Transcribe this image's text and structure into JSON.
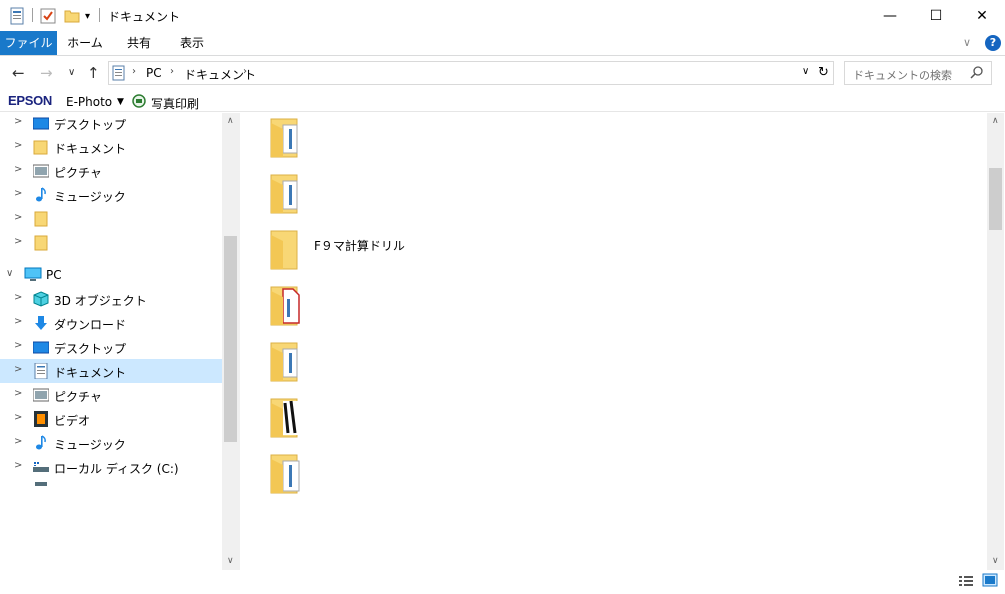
{
  "window": {
    "title": "ドキュメント",
    "minimize_glyph": "—",
    "maximize_glyph": "☐",
    "close_glyph": "✕"
  },
  "ribbon": {
    "tabs": [
      "ファイル",
      "ホーム",
      "共有",
      "表示"
    ],
    "help_glyph": "?"
  },
  "address": {
    "crumbs": [
      "PC",
      "ドキュメント"
    ],
    "search_placeholder": "ドキュメントの検索"
  },
  "epson": {
    "logo": "EPSON",
    "app": "E-Photo",
    "print_label": "写真印刷"
  },
  "nav": {
    "items": [
      {
        "label": "デスクトップ",
        "icon": "desktop-icon"
      },
      {
        "label": "ドキュメント",
        "icon": "folder-icon"
      },
      {
        "label": "ピクチャ",
        "icon": "pictures-icon"
      },
      {
        "label": "ミュージック",
        "icon": "music-icon"
      },
      {
        "label": "",
        "icon": "folder-icon"
      },
      {
        "label": "",
        "icon": "folder-icon"
      },
      {
        "label": "PC",
        "icon": "pc-icon"
      },
      {
        "label": "3D オブジェクト",
        "icon": "3d-objects-icon"
      },
      {
        "label": "ダウンロード",
        "icon": "download-icon"
      },
      {
        "label": "デスクトップ",
        "icon": "desktop-icon"
      },
      {
        "label": "ドキュメント",
        "icon": "documents-icon"
      },
      {
        "label": "ピクチャ",
        "icon": "pictures-icon"
      },
      {
        "label": "ビデオ",
        "icon": "video-icon"
      },
      {
        "label": "ミュージック",
        "icon": "music-icon"
      },
      {
        "label": "ローカル ディスク (C:)",
        "icon": "drive-icon"
      }
    ]
  },
  "files": [
    {
      "name": ""
    },
    {
      "name": ""
    },
    {
      "name": "F９マ計算ドリル"
    },
    {
      "name": ""
    },
    {
      "name": ""
    },
    {
      "name": ""
    },
    {
      "name": ""
    }
  ],
  "colors": {
    "accent": "#1979ca",
    "selection": "#cce8ff",
    "folder": "#f8d775"
  }
}
